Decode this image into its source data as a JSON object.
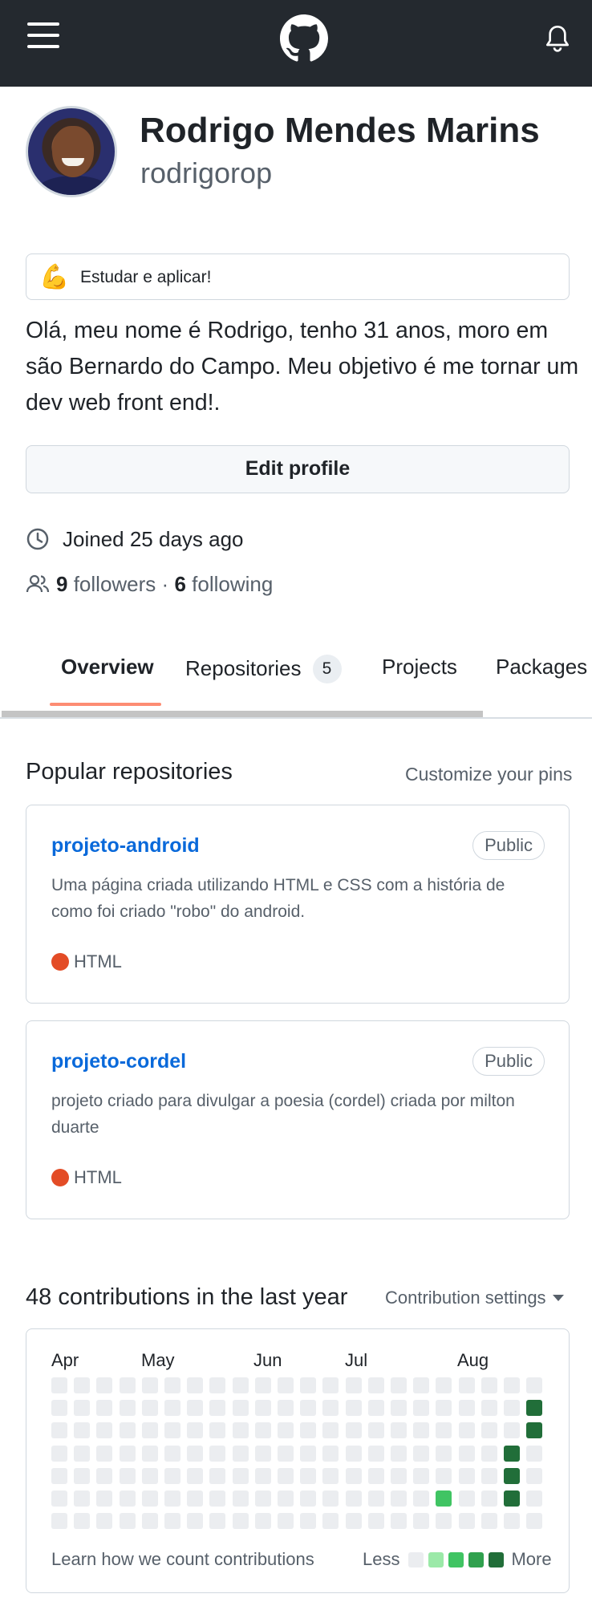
{
  "header": {
    "menu_icon": "hamburger-menu-icon",
    "logo_icon": "github-logo-icon",
    "notifications_icon": "bell-icon",
    "bg_color": "#24292f"
  },
  "profile": {
    "full_name": "Rodrigo Mendes Marins",
    "login": "rodrigorop",
    "status_emoji": "💪",
    "status_text": "Estudar e aplicar!",
    "bio": "Olá, meu nome é Rodrigo, tenho 31 anos, moro em são Bernardo do Campo. Meu objetivo é me tornar um dev web front end!.",
    "edit_button": "Edit profile",
    "joined": "Joined 25 days ago",
    "followers_count": "9",
    "followers_label": "followers",
    "separator": "·",
    "following_count": "6",
    "following_label": "following"
  },
  "tabs": [
    {
      "label": "Overview",
      "active": true
    },
    {
      "label": "Repositories",
      "count": "5"
    },
    {
      "label": "Projects"
    },
    {
      "label": "Packages"
    }
  ],
  "popular": {
    "title": "Popular repositories",
    "customize": "Customize your pins",
    "repos": [
      {
        "name": "projeto-android",
        "visibility": "Public",
        "description": "Uma página criada utilizando HTML e CSS com a história de como foi criado \"robo\" do android.",
        "language": "HTML",
        "language_color": "#e34c26"
      },
      {
        "name": "projeto-cordel",
        "visibility": "Public",
        "description": "projeto criado para divulgar a poesia (cordel) criada por milton duarte",
        "language": "HTML",
        "language_color": "#e34c26"
      }
    ]
  },
  "contributions": {
    "title": "48 contributions in the last year",
    "settings": "Contribution settings",
    "months": [
      "Apr",
      "May",
      "Jun",
      "Jul",
      "Aug"
    ],
    "learn_link": "Learn how we count contributions",
    "less": "Less",
    "more": "More",
    "colors": [
      "#ebedf0",
      "#9be9a8",
      "#40c463",
      "#30a14e",
      "#216e39"
    ],
    "week_count": 22,
    "levels": {
      "21": [
        0,
        4,
        4,
        0,
        0,
        0,
        0
      ],
      "20": [
        0,
        0,
        0,
        4,
        4,
        4,
        0
      ],
      "17": [
        0,
        0,
        0,
        0,
        0,
        2,
        0
      ]
    }
  }
}
